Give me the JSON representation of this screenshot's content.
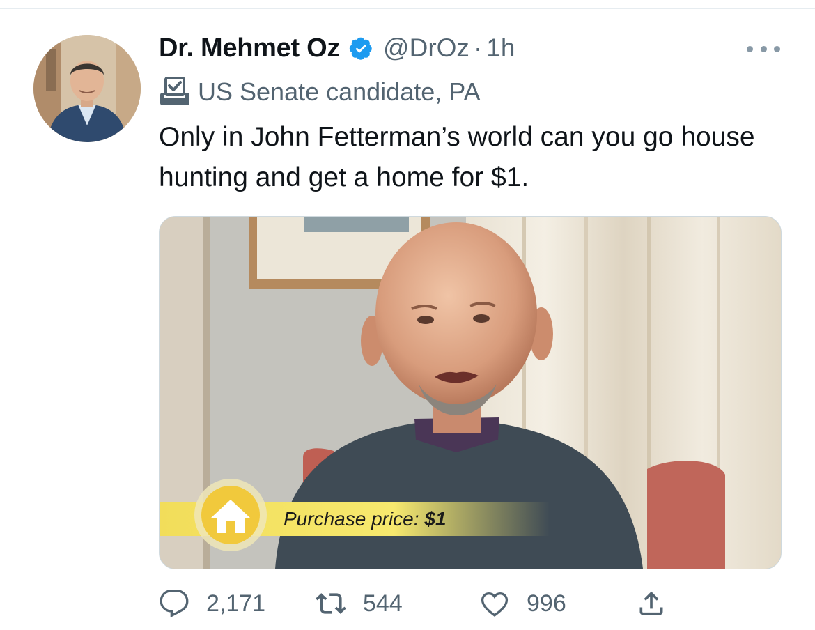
{
  "tweet": {
    "author_name": "Dr. Mehmet Oz",
    "handle": "@DrOz",
    "separator": "·",
    "time": "1h",
    "label": "US Senate candidate, PA",
    "text": "Only in John Fetterman’s world can you go house hunting and get a home for $1.",
    "media": {
      "overlay_label": "Purchase price:",
      "overlay_value": "$1"
    }
  },
  "actions": {
    "replies": "2,171",
    "retweets": "544",
    "likes": "996"
  },
  "icons": {
    "verified": "verified-badge-icon",
    "label": "ballot-box-icon",
    "more": "more-options-icon",
    "reply": "reply-icon",
    "retweet": "retweet-icon",
    "like": "heart-icon",
    "share": "share-icon"
  },
  "colors": {
    "accent": "#1d9bf0",
    "secondary_text": "#536471",
    "primary_text": "#0f1419",
    "overlay_banner": "#f2dd5a"
  }
}
